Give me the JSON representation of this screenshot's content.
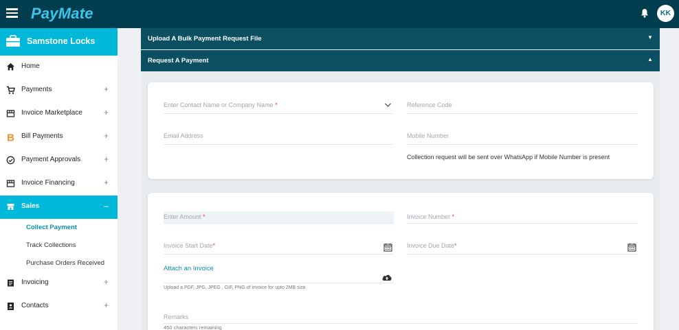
{
  "app": {
    "brand": "PayMate",
    "user_initials": "KK",
    "accent": "#00b8d9",
    "header_bg": "#003e4f"
  },
  "sidebar": {
    "company": "Samstone Locks",
    "items": [
      {
        "label": "Home",
        "icon": "home-icon",
        "expandable": false
      },
      {
        "label": "Payments",
        "icon": "cart-icon",
        "expandable": true
      },
      {
        "label": "Invoice Marketplace",
        "icon": "store-icon",
        "expandable": true
      },
      {
        "label": "Bill Payments",
        "icon": "bill-b-icon",
        "expandable": true
      },
      {
        "label": "Payment Approvals",
        "icon": "check-circle-icon",
        "expandable": true
      },
      {
        "label": "Invoice Financing",
        "icon": "storefront-icon",
        "expandable": true
      },
      {
        "label": "Sales",
        "icon": "shop-icon",
        "expandable": true,
        "expanded": true
      },
      {
        "label": "Invoicing",
        "icon": "document-icon",
        "expandable": true
      },
      {
        "label": "Contacts",
        "icon": "contacts-icon",
        "expandable": true
      }
    ],
    "plus": "+",
    "minus": "–",
    "sales_sub": [
      "Collect Payment",
      "Track Collections",
      "Purchase Orders Received"
    ]
  },
  "accordions": {
    "bulk": "Upload A Bulk Payment Request File",
    "request": "Request A Payment",
    "caret_down": "▼",
    "caret_up": "▲"
  },
  "form1": {
    "contact_label": "Enter Contact Name or Company Name ",
    "reference_label": "Reference Code",
    "email_label": "Email Address",
    "mobile_label": "Mobile Number",
    "whatsapp_note": "Collection request will be sent over WhatsApp if Mobile Number is present"
  },
  "form2": {
    "amount_label": "Enter Amount ",
    "invoice_number_label": "Invoice Number ",
    "start_date_label": "Invoice Start Date",
    "due_date_label": "Invoice Due Date",
    "attach_link": "Attach an Invoice",
    "attach_hint": "Upload a PDF, JPG, JPEG , GIF, PNG of invoice for upto 2MB size",
    "remarks_label": "Remarks",
    "chars_remaining": "450  characters remaining"
  },
  "required_mark": "*"
}
